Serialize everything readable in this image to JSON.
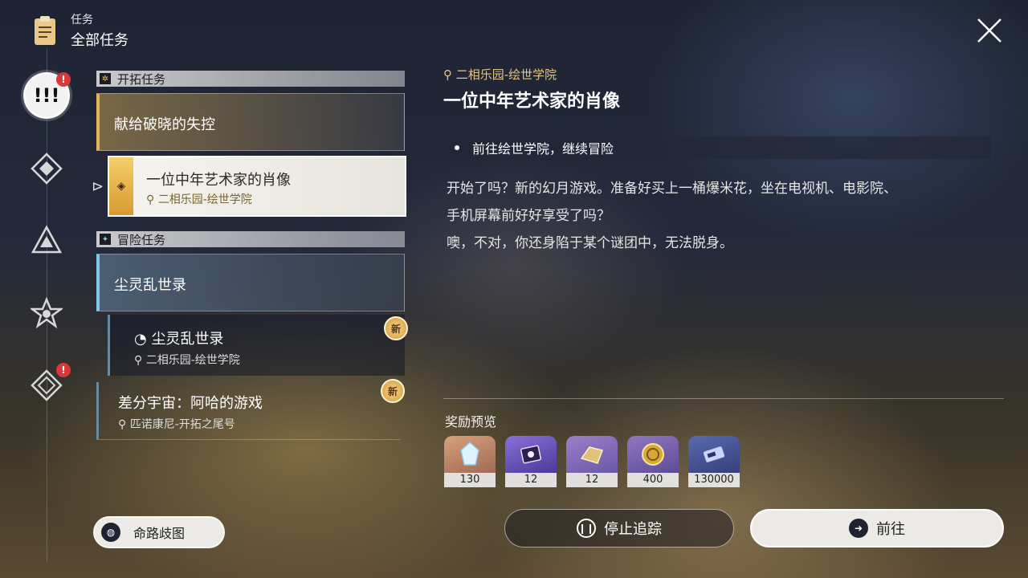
{
  "header": {
    "section_label": "任务",
    "title": "全部任务"
  },
  "rail": {
    "items": [
      {
        "icon": "all-missions-icon",
        "active": true,
        "badge": "!"
      },
      {
        "icon": "trailblaze-mission-icon"
      },
      {
        "icon": "companion-mission-icon"
      },
      {
        "icon": "adventure-mission-icon"
      },
      {
        "icon": "daily-mission-icon",
        "badge": "!"
      }
    ]
  },
  "sections": {
    "trailblaze": {
      "label": "开拓任务"
    },
    "adventure": {
      "label": "冒险任务"
    }
  },
  "missions": {
    "trailblaze_group": {
      "title": "献给破晓的失控"
    },
    "selected": {
      "title": "一位中年艺术家的肖像",
      "location": "二相乐园-绘世学院"
    },
    "adventure_group": {
      "title": "尘灵乱世录"
    },
    "adventure_sub": {
      "title": "尘灵乱世录",
      "location": "二相乐园-绘世学院",
      "badge": "新"
    },
    "diff_universe": {
      "title": "差分宇宙：阿哈的游戏",
      "location": "匹诺康尼-开拓之尾号",
      "badge": "新"
    }
  },
  "path_button": {
    "label": "命路歧图"
  },
  "detail": {
    "location": "二相乐园-绘世学院",
    "title": "一位中年艺术家的肖像",
    "objective": "前往绘世学院，继续冒险",
    "description": [
      "开始了吗？新的幻月游戏。准备好买上一桶爆米花，坐在电视机、电影院、",
      "手机屏幕前好好享受了吗？",
      "噢，不对，你还身陷于某个谜团中，无法脱身。"
    ],
    "reward_label": "奖励预览",
    "rewards": [
      {
        "name": "stellar-jade",
        "count": "130",
        "color": "#c58a6a"
      },
      {
        "name": "purple-material",
        "count": "12",
        "color": "#6a58b8"
      },
      {
        "name": "gold-material",
        "count": "12",
        "color": "#8a6ab0"
      },
      {
        "name": "credit",
        "count": "400",
        "color": "#7a68a8"
      },
      {
        "name": "exp-ticket",
        "count": "130000",
        "color": "#4a5a9a"
      }
    ]
  },
  "actions": {
    "stop_tracking": "停止追踪",
    "go": "前往"
  }
}
